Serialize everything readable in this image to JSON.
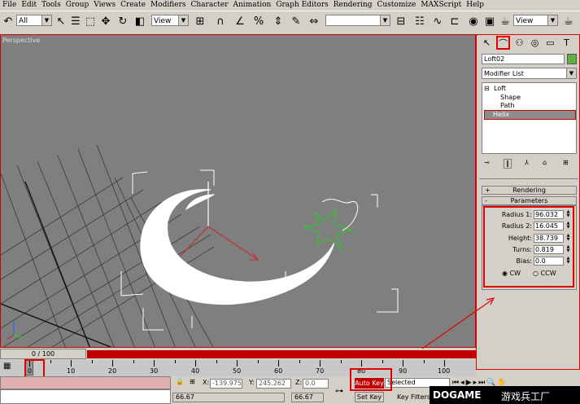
{
  "menu": [
    "File",
    "Edit",
    "Tools",
    "Group",
    "Views",
    "Create",
    "Modifiers",
    "Character",
    "Animation",
    "Graph Editors",
    "Rendering",
    "Customize",
    "MAXScript",
    "Help"
  ],
  "toolbar": {
    "selection_filter": "All",
    "ref_coord": "View",
    "named_selection": "",
    "view_right": "View"
  },
  "viewport": {
    "label": "Perspective"
  },
  "command_panel": {
    "object_name": "Loft02",
    "object_color": "#5fb040",
    "modifier_list": "Modifier List",
    "stack": {
      "root": "Loft",
      "shape": "Shape",
      "path": "Path",
      "selected": "Helix"
    },
    "rollouts": {
      "rendering": "Rendering",
      "rendering_sign": "+",
      "parameters": "Parameters",
      "parameters_sign": "-"
    },
    "params": [
      {
        "label": "Radius 1:",
        "value": "96.032"
      },
      {
        "label": "Radius 2:",
        "value": "16.045"
      },
      {
        "label": "Height:",
        "value": "38.739"
      },
      {
        "label": "Turns:",
        "value": "0.819"
      },
      {
        "label": "Bias:",
        "value": "0.0"
      }
    ],
    "direction": {
      "cw": "CW",
      "ccw": "CCW",
      "selected": "CW"
    }
  },
  "timeline": {
    "frame_label": "0 / 100",
    "ruler_labels": [
      "0",
      "10",
      "20",
      "30",
      "40",
      "50",
      "60",
      "70",
      "80",
      "90",
      "100"
    ]
  },
  "status": {
    "x_label": "X:",
    "x": "-139.975",
    "y_label": "Y:",
    "y": "245.262",
    "z_label": "Z:",
    "z": "0.0",
    "auto_key": "Auto Key",
    "key_mode": "Selected",
    "set_key": "Set Key",
    "key_filters": "Key Filters...",
    "left_value": "66.67",
    "right_value": "66.67"
  },
  "watermark": {
    "brand": "DOGAME",
    "text": "游戏兵工厂"
  },
  "colors": {
    "highlight": "#e00000",
    "viewport_bg": "#7f7f7f",
    "ui_bg": "#d4d0c8"
  }
}
